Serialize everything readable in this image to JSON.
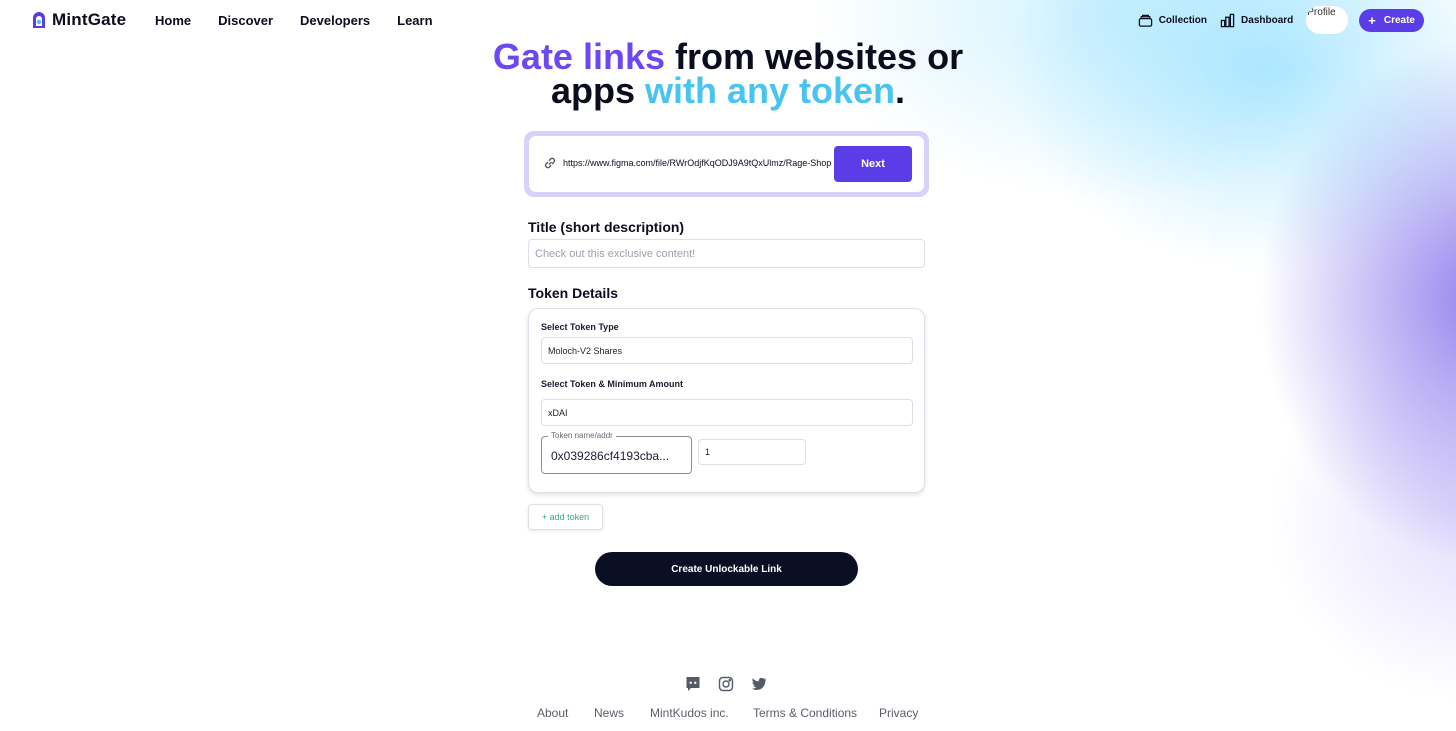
{
  "header": {
    "brand": "MintGate",
    "nav": [
      "Home",
      "Discover",
      "Developers",
      "Learn"
    ],
    "collection_label": "Collection",
    "dashboard_label": "Dashboard",
    "profile_alt": "Profile",
    "create_label": "Create"
  },
  "hero": {
    "line1_a": "Gate links",
    "line1_b": " from websites or",
    "line2_a": "apps ",
    "line2_b": "with any token",
    "line2_c": "."
  },
  "url_bar": {
    "value": "https://www.figma.com/file/RWrOdjfKqODJ9A9tQxUlmz/Rage-Shop",
    "next_label": "Next"
  },
  "title_section": {
    "label": "Title (short description)",
    "placeholder": "Check out this exclusive content!"
  },
  "token_details": {
    "heading": "Token Details",
    "type_label": "Select Token Type",
    "type_value": "Moloch-V2 Shares",
    "min_label": "Select Token & Minimum Amount",
    "network_value": "xDAI",
    "token_field_legend": "Token name/addr",
    "token_field_value": "0x039286cf4193cba...",
    "amount_value": "1"
  },
  "add_token_label": "+ add token",
  "unlock_button_label": "Create Unlockable Link",
  "footer": {
    "social_icons": [
      "discord-icon",
      "instagram-icon",
      "twitter-icon"
    ],
    "links": [
      "About",
      "News",
      "MintKudos inc.",
      "Terms & Conditions",
      "Privacy"
    ]
  },
  "colors": {
    "accent_purple": "#5a3de6",
    "hero_purple": "#6b48f2",
    "hero_cyan": "#49c3f0",
    "dark_button": "#0b0f24",
    "add_token_green": "#2fb07e"
  }
}
